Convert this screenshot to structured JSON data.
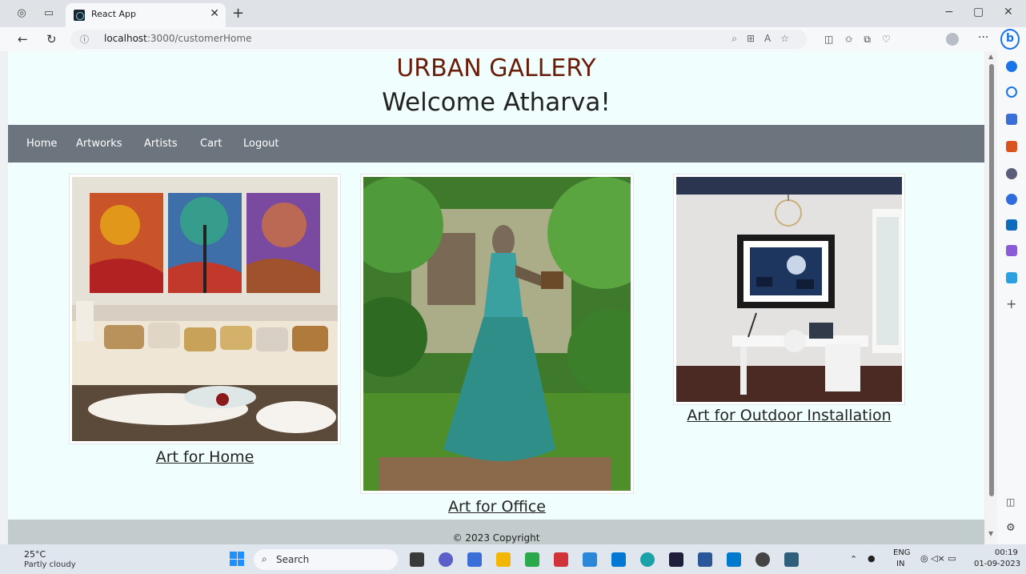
{
  "browser": {
    "tab_title": "React App",
    "tab_close": "✕",
    "new_tab": "+",
    "url_host": "localhost",
    "url_rest": ":3000/customerHome",
    "win_minimize": "−",
    "win_restore": "▢",
    "win_close": "✕",
    "more": "···",
    "copilot": "b"
  },
  "page": {
    "title": "URBAN GALLERY",
    "welcome": "Welcome Atharva!",
    "nav": [
      "Home",
      "Artworks",
      "Artists",
      "Cart",
      "Logout"
    ],
    "cards": [
      {
        "caption": "Art for Home"
      },
      {
        "caption": "Art for Office"
      },
      {
        "caption": "Art for Outdoor Installation"
      }
    ],
    "footer": "© 2023 Copyright"
  },
  "taskbar": {
    "temp": "25°C",
    "weather": "Partly cloudy",
    "search": "Search",
    "lang_top": "ENG",
    "lang_bottom": "IN",
    "time": "00:19",
    "date": "01-09-2023"
  },
  "colors": {
    "page_bg": "#f0fffe",
    "navbar": "#6c757d",
    "title": "#6a1c08",
    "footer": "#c3cccc"
  }
}
